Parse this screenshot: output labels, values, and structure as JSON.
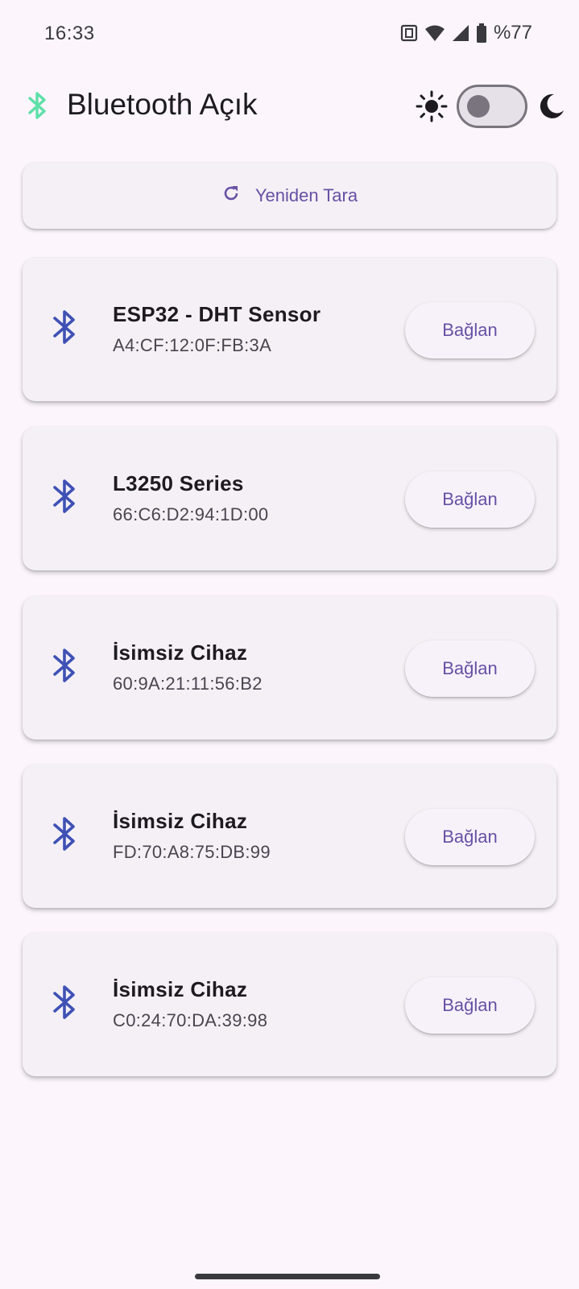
{
  "status_bar": {
    "time": "16:33",
    "battery": "%77",
    "icons": [
      "nfc-icon",
      "wifi-icon",
      "cell-signal-icon",
      "battery-icon"
    ]
  },
  "app_bar": {
    "title": "Bluetooth Açık",
    "icon": "bluetooth-icon",
    "theme_toggle": {
      "light_icon": "sun-icon",
      "dark_icon": "moon-icon",
      "dark_mode_on": false
    }
  },
  "rescan_button": {
    "label": "Yeniden Tara",
    "icon": "refresh-icon"
  },
  "devices": [
    {
      "name": "ESP32 - DHT Sensor",
      "address": "A4:CF:12:0F:FB:3A",
      "connect_label": "Bağlan"
    },
    {
      "name": "L3250 Series",
      "address": "66:C6:D2:94:1D:00",
      "connect_label": "Bağlan"
    },
    {
      "name": "İsimsiz Cihaz",
      "address": "60:9A:21:11:56:B2",
      "connect_label": "Bağlan"
    },
    {
      "name": "İsimsiz Cihaz",
      "address": "FD:70:A8:75:DB:99",
      "connect_label": "Bağlan"
    },
    {
      "name": "İsimsiz Cihaz",
      "address": "C0:24:70:DA:39:98",
      "connect_label": "Bağlan"
    }
  ],
  "colors": {
    "background": "#fcf6fc",
    "accent": "#6750a4",
    "device_icon": "#3f51b5",
    "header_bt_icon": "#5ee0a8",
    "card": "#f5f0f6"
  }
}
